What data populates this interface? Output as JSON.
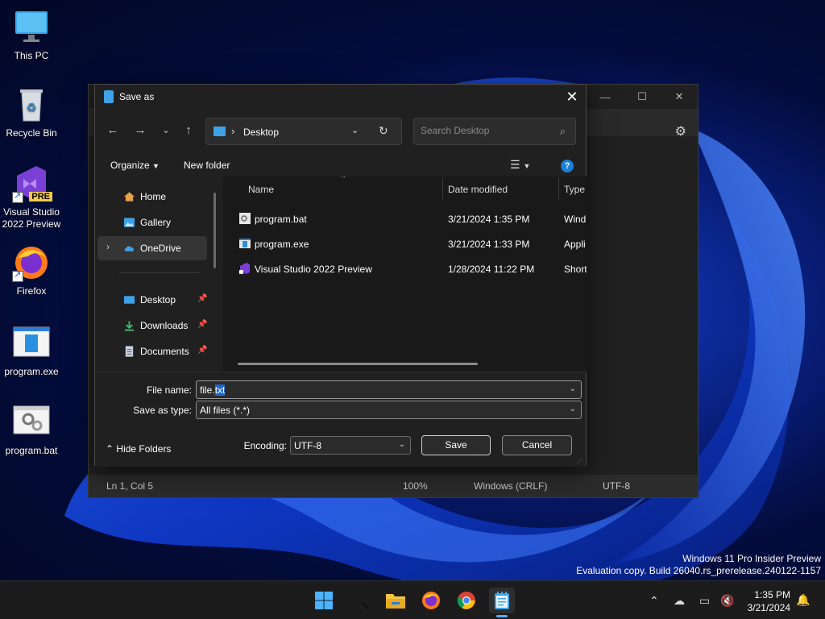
{
  "desktop": {
    "icons": [
      {
        "label": "This PC",
        "icon": "monitor-icon"
      },
      {
        "label": "Recycle Bin",
        "icon": "recycle-bin-icon"
      },
      {
        "label": "Visual Studio 2022 Preview",
        "label_line1": "Visual Studio",
        "label_line2": "2022 Preview",
        "badge": "PRE",
        "icon": "visual-studio-icon"
      },
      {
        "label": "Firefox",
        "icon": "firefox-icon"
      },
      {
        "label": "program.exe",
        "icon": "exe-file-icon"
      },
      {
        "label": "program.bat",
        "icon": "bat-file-icon"
      }
    ]
  },
  "notepad": {
    "status": {
      "position": "Ln 1, Col 5",
      "zoom": "100%",
      "line_endings": "Windows (CRLF)",
      "encoding": "UTF-8"
    }
  },
  "dialog": {
    "title": "Save as",
    "address": {
      "location": "Desktop"
    },
    "search": {
      "placeholder": "Search Desktop"
    },
    "commands": {
      "organize": "Organize",
      "new_folder": "New folder"
    },
    "nav": {
      "home": "Home",
      "gallery": "Gallery",
      "onedrive": "OneDrive",
      "desktop": "Desktop",
      "downloads": "Downloads",
      "documents": "Documents"
    },
    "columns": {
      "name": "Name",
      "date": "Date modified",
      "type": "Type"
    },
    "files": [
      {
        "name": "program.bat",
        "date": "3/21/2024 1:35 PM",
        "type": "Wind"
      },
      {
        "name": "program.exe",
        "date": "3/21/2024 1:33 PM",
        "type": "Appli"
      },
      {
        "name": "Visual Studio 2022 Preview",
        "date": "1/28/2024 11:22 PM",
        "type": "Short"
      }
    ],
    "file_name_label": "File name:",
    "file_name_prefix": "file.",
    "file_name_selected": "txt",
    "save_as_type_label": "Save as type:",
    "save_as_type_value": "All files  (*.*)",
    "hide_folders": "Hide Folders",
    "encoding_label": "Encoding:",
    "encoding_value": "UTF-8",
    "save": "Save",
    "cancel": "Cancel"
  },
  "watermark": {
    "line1": "Windows 11 Pro Insider Preview",
    "line2": "Evaluation copy. Build 26040.rs_prerelease.240122-1157"
  },
  "taskbar": {
    "apps": [
      "start-icon",
      "search-icon",
      "file-explorer-icon",
      "firefox-icon",
      "chrome-icon",
      "notepad-icon"
    ],
    "clock": {
      "time": "1:35 PM",
      "date": "3/21/2024"
    }
  },
  "colors": {
    "accent": "#1e66c8",
    "dialog_bg": "#202020",
    "file_pane_bg": "#191919"
  }
}
